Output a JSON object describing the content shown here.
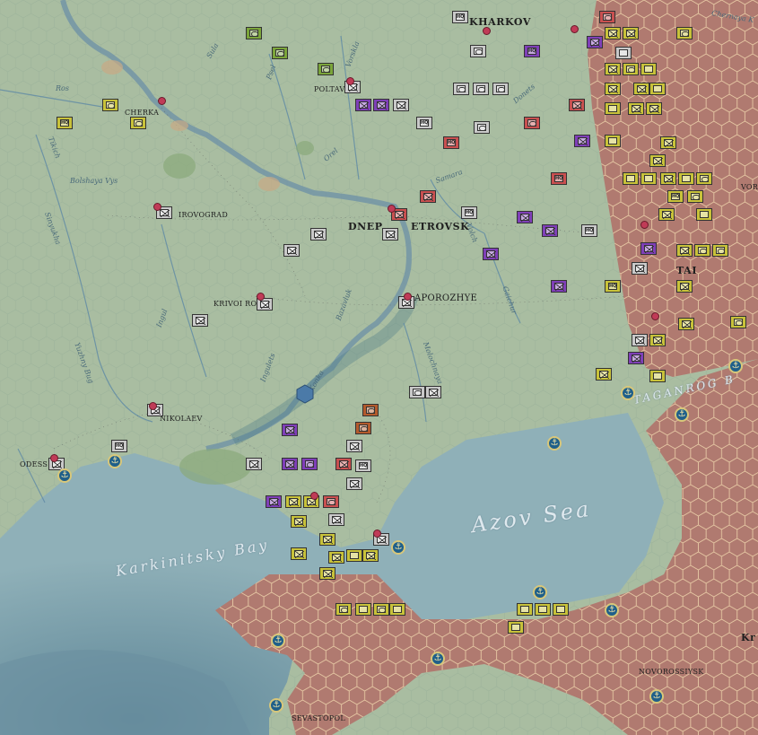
{
  "cities": {
    "kharkov": "KHARKOV",
    "poltava": "POLTAVA",
    "cherkassy": "CHERKA",
    "kirovograd": "IROVOGRAD",
    "dnepr_a": "DNEP",
    "dnepr_b": "ETROVSK",
    "zaporozhye": "APOROZHYE",
    "krivoi_rog": "KRIVOI RO",
    "nikolaev": "NIKOLAEV",
    "odessa": "ODESS",
    "sevastopol": "SEVASTOPOL",
    "novorossiysk": "NOVOROSSIYSK",
    "taganrog": "TAGANROG B",
    "kr": "Kr",
    "vor": "VOR",
    "tal": "TAI"
  },
  "rivers": {
    "sula": "Sula",
    "psel": "Psel",
    "vorskla": "Vorskla",
    "ros": "Ros",
    "donets": "Donets",
    "orel": "Orel",
    "samara": "Samara",
    "bolshaya_vys": "Bolshaya Vys",
    "tikich": "Tikich",
    "sinyukha": "Sinyukha",
    "volch": "Volch",
    "ingul": "Ingul",
    "ingulets": "Ingulets",
    "bazavluk": "Bazavluk",
    "konka": "Konka",
    "gaichur": "Gaichur",
    "molochnaya": "Molochnaya",
    "yuzhny_bug": "Yuzhny Bug",
    "chernaya_kalitva": "Chernaya K"
  },
  "seas": {
    "azov": "Azov Sea",
    "karkinitsky": "Karkinitsky Bay"
  },
  "palette": {
    "land": "#a9bda1",
    "sea": "#8fb0b8",
    "hex_terrain": "#b9867a",
    "soviet": "#7ba53a",
    "axis_grey": "#c9c9c9",
    "axis_red": "#c95050",
    "axis_purple": "#7f3fb8",
    "axis_yellow": "#c8c23a",
    "marker": "#c03b57",
    "port": "#1f5f8a"
  }
}
